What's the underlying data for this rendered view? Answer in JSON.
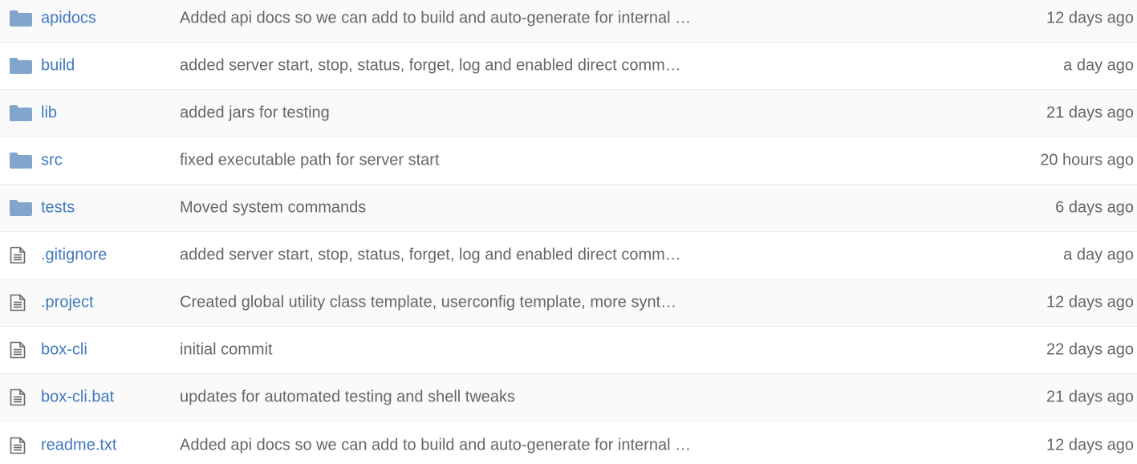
{
  "colors": {
    "link": "#4078c0",
    "text": "#666666",
    "folder_icon": "#80a6cd",
    "file_icon": "#666666"
  },
  "files": [
    {
      "icon": "folder-icon",
      "type": "dir",
      "name": "apidocs",
      "message": "Added api docs so we can add to build and auto-generate for internal …",
      "age": "12 days ago"
    },
    {
      "icon": "folder-icon",
      "type": "dir",
      "name": "build",
      "message": "added server start, stop, status, forget, log and enabled direct comm…",
      "age": "a day ago"
    },
    {
      "icon": "folder-icon",
      "type": "dir",
      "name": "lib",
      "message": "added jars for testing",
      "age": "21 days ago"
    },
    {
      "icon": "folder-icon",
      "type": "dir",
      "name": "src",
      "message": "fixed executable path for server start",
      "age": "20 hours ago"
    },
    {
      "icon": "folder-icon",
      "type": "dir",
      "name": "tests",
      "message": "Moved system commands",
      "age": "6 days ago"
    },
    {
      "icon": "file-icon",
      "type": "file",
      "name": ".gitignore",
      "message": "added server start, stop, status, forget, log and enabled direct comm…",
      "age": "a day ago"
    },
    {
      "icon": "file-icon",
      "type": "file",
      "name": ".project",
      "message": "Created global utility class template, userconfig template, more synt…",
      "age": "12 days ago"
    },
    {
      "icon": "file-icon",
      "type": "file",
      "name": "box-cli",
      "message": "initial commit",
      "age": "22 days ago"
    },
    {
      "icon": "file-icon",
      "type": "file",
      "name": "box-cli.bat",
      "message": "updates for automated testing and shell tweaks",
      "age": "21 days ago"
    },
    {
      "icon": "file-icon",
      "type": "file",
      "name": "readme.txt",
      "message": "Added api docs so we can add to build and auto-generate for internal …",
      "age": "12 days ago"
    }
  ]
}
